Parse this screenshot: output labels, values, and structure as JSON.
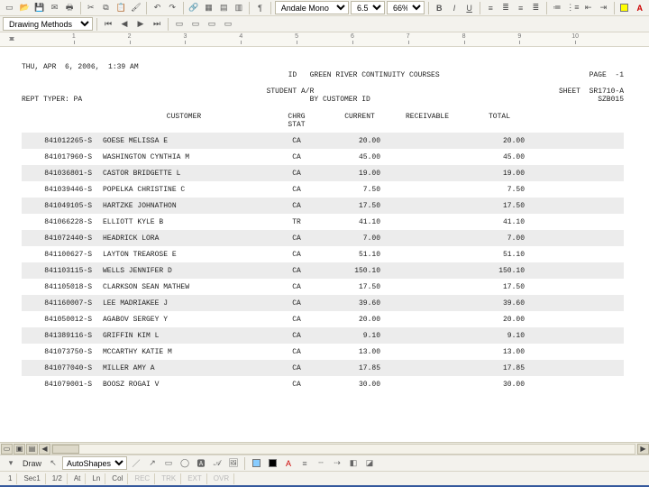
{
  "toolbar1": {
    "font_name": "Andale Mono",
    "font_size": "6.5",
    "zoom": "66%"
  },
  "toolbar2_label": "Drawing Methods",
  "ruler_numbers": [
    "1",
    "2",
    "3",
    "4",
    "5",
    "6",
    "7",
    "8",
    "9",
    "10"
  ],
  "report": {
    "date_time": "THU, APR  6, 2006,  1:39 AM",
    "page_label": "PAGE",
    "page_no": "-1",
    "id_label": "ID",
    "title1": "GREEN RIVER CONTINUITY COURSES",
    "title2": "STUDENT A/R",
    "title3": "BY CUSTOMER ID",
    "sheet_label": "SHEET",
    "sheet_id": "SR1710-A",
    "sheet_code": "SZB015",
    "rept_type": "REPT TYPER: PA",
    "cols": {
      "customer": "CUSTOMER",
      "chrg_stat": "CHRG\nSTAT",
      "current": "CURRENT",
      "receivable": "RECEIVABLE",
      "total": "TOTAL"
    },
    "rows": [
      {
        "id": "841012265-S",
        "name": "GOESE MELISSA E",
        "stat": "CA",
        "cur": "20.00",
        "recv": "",
        "tot": "20.00"
      },
      {
        "id": "841017960-S",
        "name": "WASHINGTON CYNTHIA M",
        "stat": "CA",
        "cur": "45.00",
        "recv": "",
        "tot": "45.00"
      },
      {
        "id": "841036801-S",
        "name": "CASTOR BRIDGETTE L",
        "stat": "CA",
        "cur": "19.00",
        "recv": "",
        "tot": "19.00"
      },
      {
        "id": "841039446-S",
        "name": "POPELKA CHRISTINE C",
        "stat": "CA",
        "cur": "7.50",
        "recv": "",
        "tot": "7.50"
      },
      {
        "id": "841049105-S",
        "name": "HARTZKE JOHNATHON",
        "stat": "CA",
        "cur": "17.50",
        "recv": "",
        "tot": "17.50"
      },
      {
        "id": "841066228-S",
        "name": "ELLIOTT KYLE B",
        "stat": "TR",
        "cur": "41.10",
        "recv": "",
        "tot": "41.10"
      },
      {
        "id": "841072440-S",
        "name": "HEADRICK LORA",
        "stat": "CA",
        "cur": "7.00",
        "recv": "",
        "tot": "7.00"
      },
      {
        "id": "841100627-S",
        "name": "LAYTON TREAROSE E",
        "stat": "CA",
        "cur": "51.10",
        "recv": "",
        "tot": "51.10"
      },
      {
        "id": "841103115-S",
        "name": "WELLS JENNIFER D",
        "stat": "CA",
        "cur": "150.10",
        "recv": "",
        "tot": "150.10"
      },
      {
        "id": "841105018-S",
        "name": "CLARKSON SEAN MATHEW",
        "stat": "CA",
        "cur": "17.50",
        "recv": "",
        "tot": "17.50"
      },
      {
        "id": "841160007-S",
        "name": "LEE MADRIAKEE J",
        "stat": "CA",
        "cur": "39.60",
        "recv": "",
        "tot": "39.60"
      },
      {
        "id": "841050012-S",
        "name": "AGABOV SERGEY Y",
        "stat": "CA",
        "cur": "20.00",
        "recv": "",
        "tot": "20.00"
      },
      {
        "id": "841389116-S",
        "name": "GRIFFIN KIM L",
        "stat": "CA",
        "cur": "9.10",
        "recv": "",
        "tot": "9.10"
      },
      {
        "id": "841073750-S",
        "name": "MCCARTHY KATIE M",
        "stat": "CA",
        "cur": "13.00",
        "recv": "",
        "tot": "13.00"
      },
      {
        "id": "841077040-S",
        "name": "MILLER AMY A",
        "stat": "CA",
        "cur": "17.85",
        "recv": "",
        "tot": "17.85"
      },
      {
        "id": "841079001-S",
        "name": "BOOSZ ROGAI V",
        "stat": "CA",
        "cur": "30.00",
        "recv": "",
        "tot": "30.00"
      }
    ]
  },
  "drawbar": {
    "draw_label": "Draw",
    "autoshapes": "AutoShapes"
  },
  "status": {
    "page": "1",
    "sec": "Sec",
    "sec_v": "1",
    "pages": "1/2",
    "at": "At",
    "ln": "Ln",
    "col": "Col",
    "rec": "REC",
    "trk": "TRK",
    "ext": "EXT",
    "ovr": "OVR"
  }
}
